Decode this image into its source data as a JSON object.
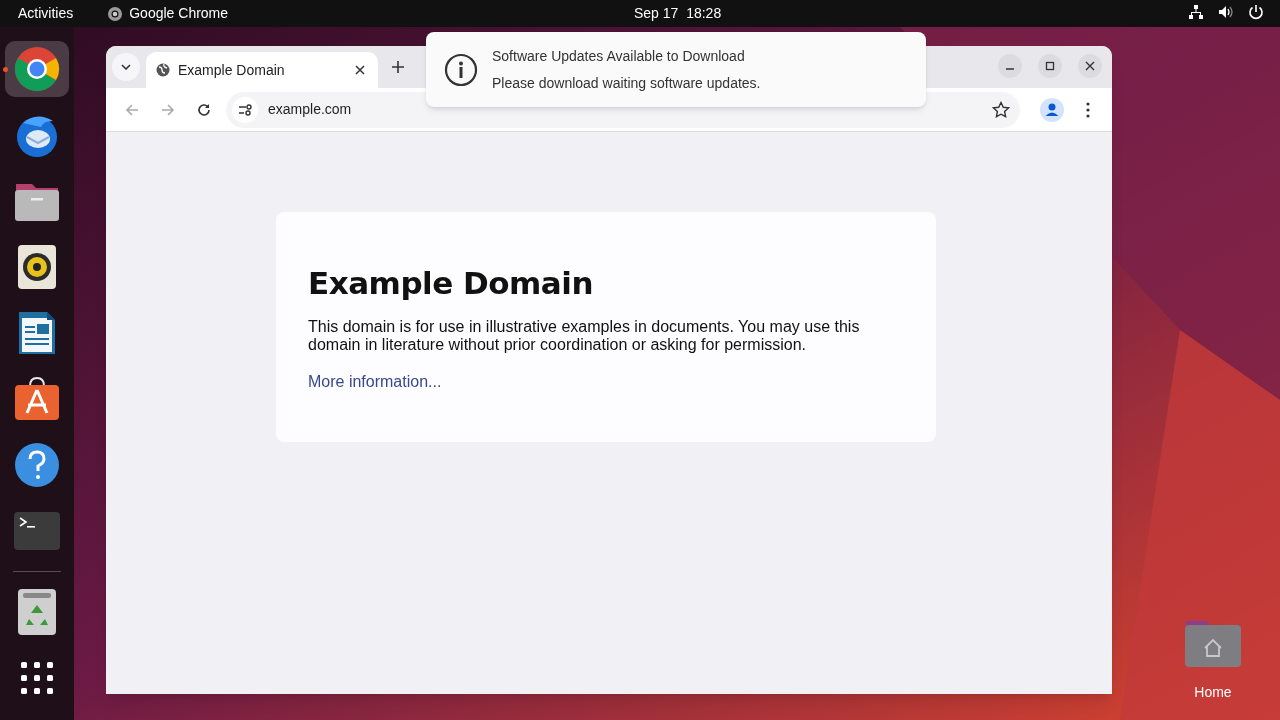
{
  "top_bar": {
    "activities": "Activities",
    "app_name": "Google Chrome",
    "clock": "Sep 17  18:28"
  },
  "dock": {
    "items": [
      {
        "kind": "chrome",
        "running": true
      },
      {
        "kind": "mail",
        "running": false
      },
      {
        "kind": "files",
        "running": false
      },
      {
        "kind": "music",
        "running": false
      },
      {
        "kind": "writer",
        "running": false
      },
      {
        "kind": "store",
        "running": false
      },
      {
        "kind": "help",
        "running": false
      },
      {
        "kind": "terminal",
        "running": false
      },
      {
        "kind": "trash",
        "running": false
      },
      {
        "kind": "apps",
        "running": false
      }
    ]
  },
  "browser": {
    "tab": {
      "title": "Example Domain"
    },
    "address": "example.com",
    "page": {
      "heading": "Example Domain",
      "body": "This domain is for use in illustrative examples in documents. You may use this domain in literature without prior coordination or asking for permission.",
      "link": "More information..."
    }
  },
  "notification": {
    "title": "Software Updates Available to Download",
    "body": "Please download waiting software updates."
  },
  "desktop_icons": [
    {
      "kind": "home-folder",
      "label": "Home"
    }
  ]
}
